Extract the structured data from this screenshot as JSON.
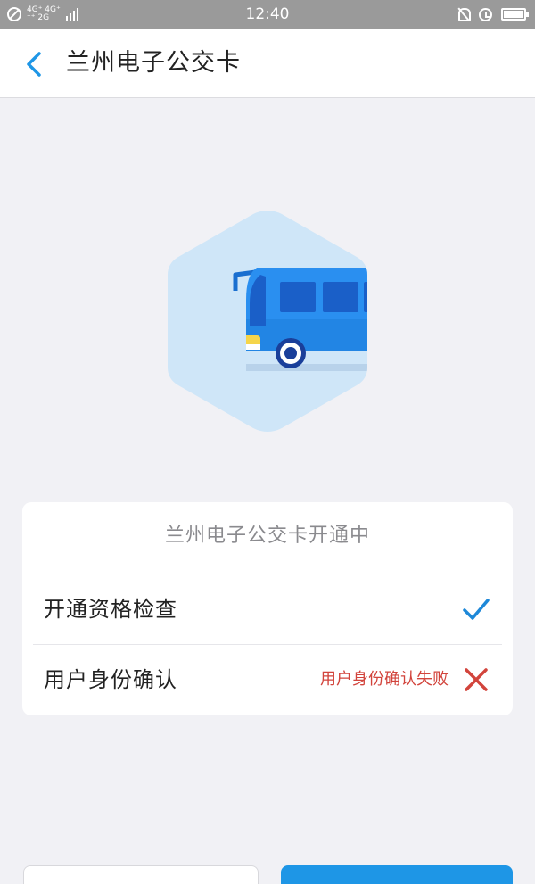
{
  "status_bar": {
    "network_top": "4G⁺ 4G⁺",
    "network_bottom": "⁺⁺ 2G",
    "time": "12:40"
  },
  "header": {
    "title": "兰州电子公交卡",
    "back_icon": "chevron-left-icon"
  },
  "hero": {
    "icon": "bus-icon"
  },
  "card": {
    "title": "兰州电子公交卡开通中",
    "steps": [
      {
        "label": "开通资格检查",
        "status_text": "",
        "status": "success",
        "icon": "checkmark-icon"
      },
      {
        "label": "用户身份确认",
        "status_text": "用户身份确认失败",
        "status": "failed",
        "icon": "cross-icon"
      }
    ]
  },
  "colors": {
    "accent_blue": "#1e96e6",
    "error_red": "#d2443c",
    "hex_bg": "#cfe6f8",
    "page_bg": "#f1f1f5"
  }
}
